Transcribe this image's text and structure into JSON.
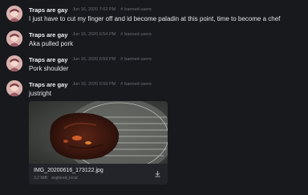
{
  "messages": [
    {
      "sender": "Traps are gay",
      "time": "Jun 16, 2020 7:02 PM",
      "room": "banned-users",
      "text": "I just have to cut my finger off and id become paladin at this point, time to become a chef"
    },
    {
      "sender": "Traps are gay",
      "time": "Jun 16, 2020 6:54 PM",
      "room": "banned-users",
      "text": "Aka pulled pork"
    },
    {
      "sender": "Traps are gay",
      "time": "Jun 16, 2020 6:59 PM",
      "room": "banned-users",
      "text": "Pork shoulder"
    },
    {
      "sender": "Traps are gay",
      "time": "Jun 16, 2020 6:59 PM",
      "room": "banned-users",
      "text": "justright"
    }
  ],
  "attachment": {
    "filename": "IMG_20200616_173122.jpg",
    "size": "3.2 MiB",
    "source": "explored_local"
  },
  "icons": {
    "room_icon": "hash-icon",
    "download_icon": "download-icon"
  },
  "colors": {
    "background": "#18191d",
    "muted_text": "#6b6d75"
  }
}
